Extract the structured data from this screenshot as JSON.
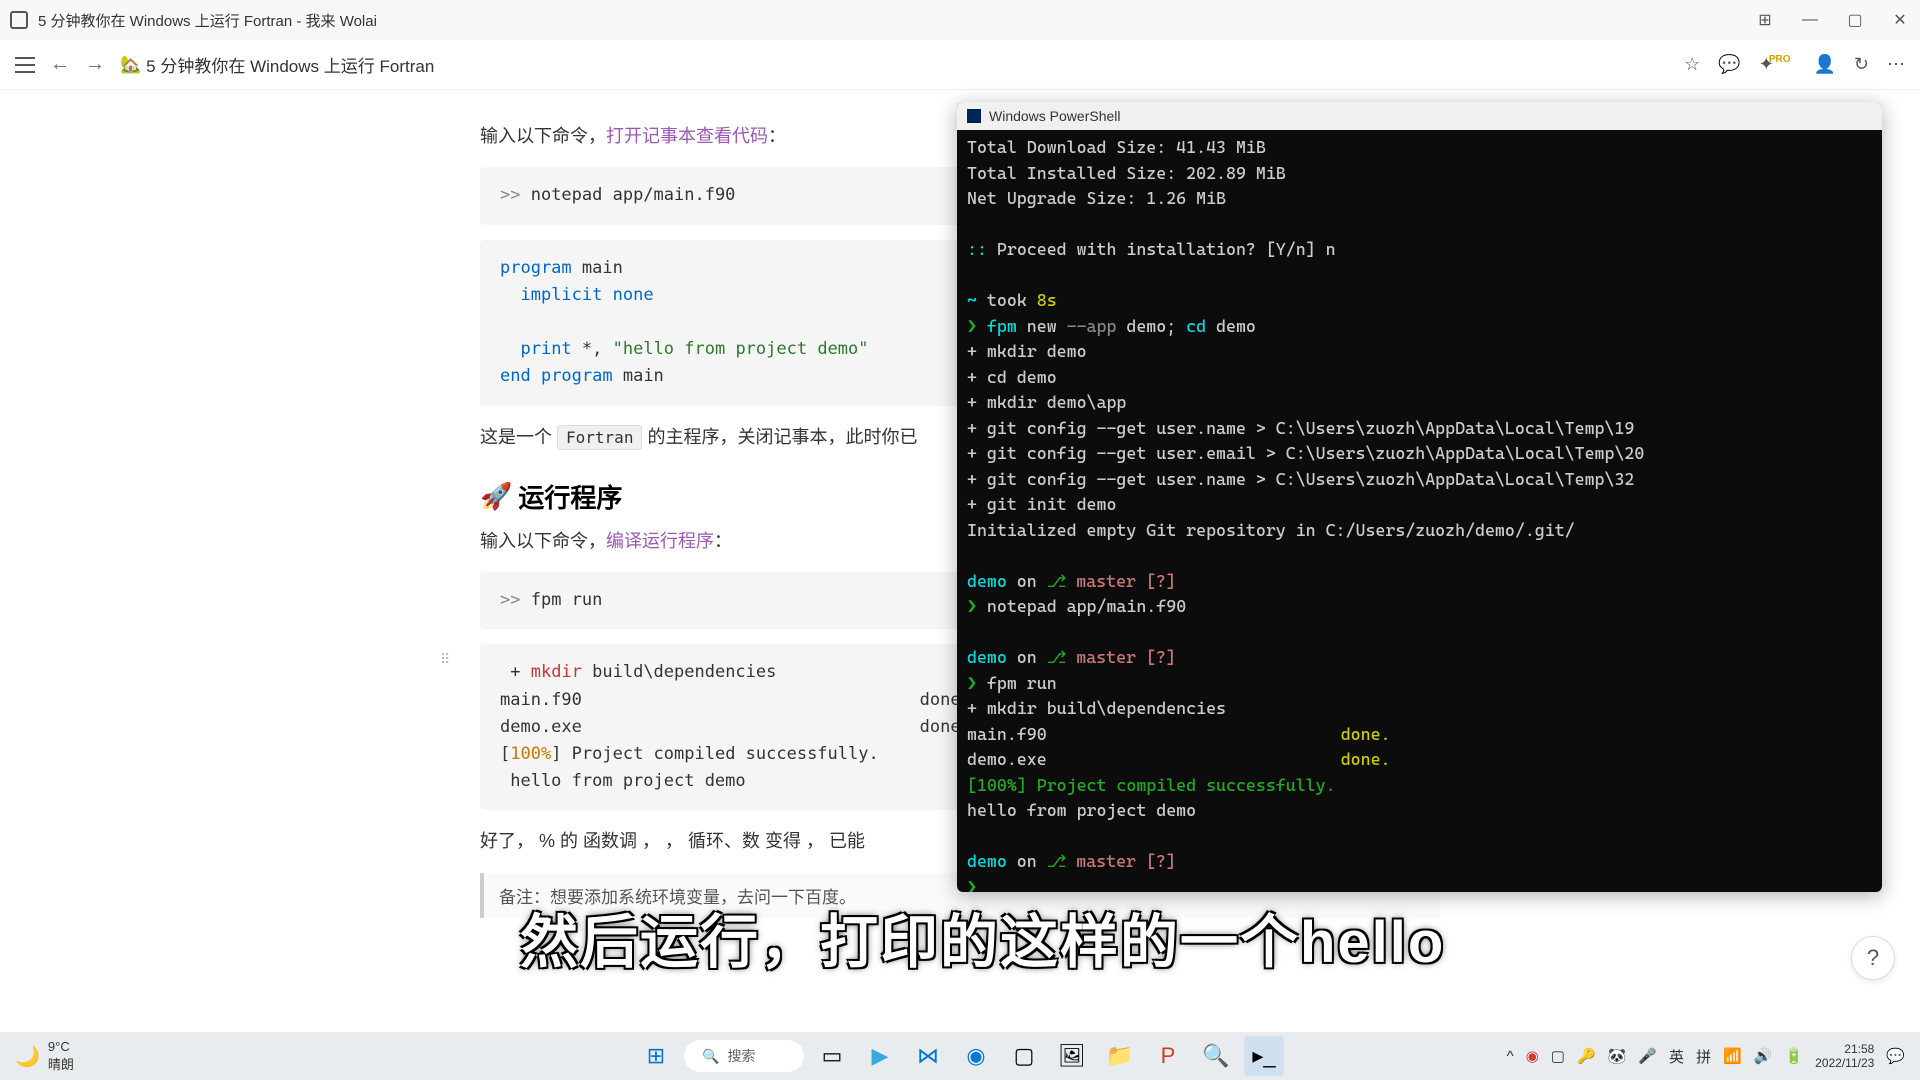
{
  "window": {
    "title": "5 分钟教你在 Windows 上运行 Fortran - 我来 Wolai"
  },
  "nav": {
    "breadcrumb_icon": "🏡",
    "breadcrumb": "5 分钟教你在 Windows 上运行 Fortran",
    "pro": "PRO"
  },
  "content": {
    "p1_a": "输入以下命令，",
    "p1_link": "打开记事本查看代码",
    "p1_b": "：",
    "code1_prompt": ">> ",
    "code1": "notepad app/main.f90",
    "code2": {
      "l1a": "program",
      "l1b": " main",
      "l2a": "implicit",
      "l2b": " none",
      "l3a": "print",
      "l3b": " *, ",
      "l3c": "\"hello from project demo\"",
      "l4a": "end",
      "l4b": " program",
      "l4c": " main"
    },
    "p2_a": "这是一个 ",
    "p2_code": "Fortran",
    "p2_b": " 的主程序，关闭记事本，此时你已",
    "h2_icon": "🚀",
    "h2": "运行程序",
    "p3_a": "输入以下命令，",
    "p3_link": "编译运行程序",
    "p3_b": "：",
    "code3_prompt": ">> ",
    "code3": "fpm run",
    "code4": {
      "l1a": " + ",
      "l1b": "mkdir",
      "l1c": " build\\dependencies",
      "l2a": "main.f90",
      "l2b": "done.",
      "l3a": "demo.exe",
      "l3b": "done.",
      "l4a": "[",
      "l4b": "100%",
      "l4c": "] Project compiled successfully.",
      "l5": " hello from project demo"
    },
    "p4": "好了，                                  % 的                                     函数调        ，           ，   循环、数                  变得        ，   已能",
    "quote": "备注：想要添加系统环境变量，去问一下百度。"
  },
  "terminal": {
    "title": "Windows PowerShell",
    "lines": {
      "l1": "Total Download Size:    41.43 MiB",
      "l2": "Total Installed Size:  202.89 MiB",
      "l3": "Net Upgrade Size:        1.26 MiB",
      "l4a": ":: ",
      "l4b": "Proceed with installation? [Y/n] n",
      "l5a": "~",
      "l5b": " took ",
      "l5c": "8s",
      "l6a": "❯",
      "l6b": " fpm",
      "l6c": " new",
      "l6d": " --app",
      "l6e": " demo; ",
      "l6f": "cd",
      "l6g": " demo",
      "l7": " + mkdir demo",
      "l8": " + cd demo",
      "l9": " + mkdir demo\\app",
      "l10": " + git config --get user.name > C:\\Users\\zuozh\\AppData\\Local\\Temp\\19",
      "l11": " + git config --get user.email > C:\\Users\\zuozh\\AppData\\Local\\Temp\\20",
      "l12": " + git config --get user.name > C:\\Users\\zuozh\\AppData\\Local\\Temp\\32",
      "l13": " + git init demo",
      "l14": "Initialized empty Git repository in C:/Users/zuozh/demo/.git/",
      "p1a": "demo",
      "p1b": " on ",
      "p1c": "⎇ ",
      "p1d": "master",
      "p1e": " [?]",
      "c1a": "❯",
      "c1b": " notepad app/main.f90",
      "c2a": "❯",
      "c2b": " fpm run",
      "l15": " + mkdir build\\dependencies",
      "l16a": "main.f90",
      "l16b": "done.",
      "l17a": "demo.exe",
      "l17b": "done.",
      "l18": "[100%] Project compiled successfully.",
      "l19": "hello from project demo",
      "c3": "❯"
    }
  },
  "caption": "然后运行，打印的这样的一个hello",
  "taskbar": {
    "weather_temp": "9°C",
    "weather_desc": "晴朗",
    "search": "搜索",
    "ime1": "英",
    "ime2": "拼",
    "time": "21:58",
    "date": "2022/11/23"
  },
  "help": "?"
}
